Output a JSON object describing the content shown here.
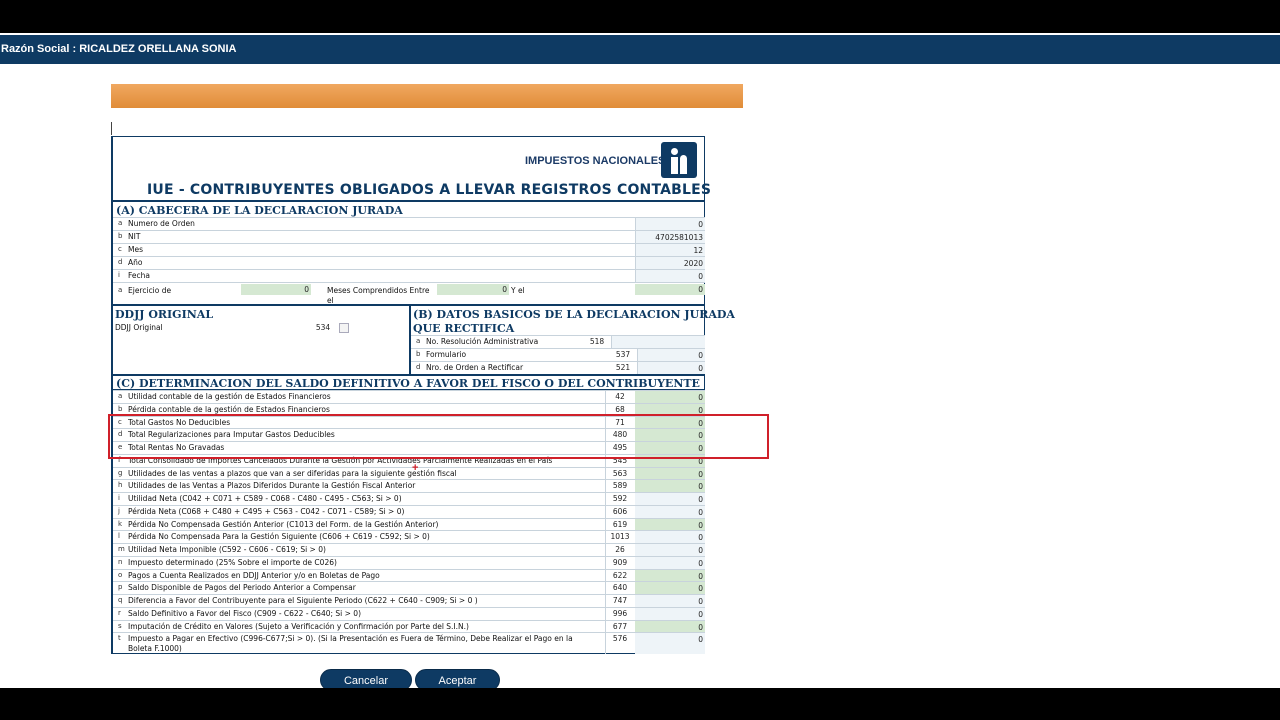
{
  "header": {
    "razon_social": "Razón Social : RICALDEZ ORELLANA SONIA"
  },
  "logo": {
    "text": "IMPUESTOS NACIONALES"
  },
  "title": "IUE - CONTRIBUYENTES OBLIGADOS A LLEVAR REGISTROS CONTABLES",
  "sectionA": {
    "title": "(A) CABECERA DE LA DECLARACION JURADA",
    "rows": [
      {
        "letter": "a",
        "label": "Numero de Orden",
        "value": "0"
      },
      {
        "letter": "b",
        "label": "NIT",
        "value": "4702581013"
      },
      {
        "letter": "c",
        "label": "Mes",
        "value": "12"
      },
      {
        "letter": "d",
        "label": "Año",
        "value": "2020"
      },
      {
        "letter": "i",
        "label": "Fecha",
        "value": "0"
      }
    ],
    "ejercicio": {
      "letter": "a",
      "label": "Ejercicio de",
      "value": "0",
      "meses_label": "Meses Comprendidos Entre el",
      "meses_value": "0",
      "yel_label": "Y el",
      "yel_value": "0"
    }
  },
  "ddjj": {
    "title": "DDJJ ORIGINAL",
    "label": "DDJJ Original",
    "code": "534"
  },
  "sectionB": {
    "title_line1": "(B) DATOS BASICOS DE LA DECLARACION JURADA",
    "title_line2": "QUE RECTIFICA",
    "rows": [
      {
        "letter": "a",
        "label": "No. Resolución Administrativa",
        "code": "518",
        "value": ""
      },
      {
        "letter": "b",
        "label": "Formulario",
        "code": "537",
        "value": "0"
      },
      {
        "letter": "d",
        "label": "Nro. de Orden a Rectificar",
        "code": "521",
        "value": "0"
      }
    ]
  },
  "sectionC": {
    "title": "(C) DETERMINACION DEL SALDO DEFINITIVO A FAVOR DEL FISCO O DEL CONTRIBUYENTE",
    "rows": [
      {
        "letter": "a",
        "label": "Utilidad contable de la gestión de Estados Financieros",
        "code": "42",
        "value": "0"
      },
      {
        "letter": "b",
        "label": "Pérdida contable de la gestión de Estados Financieros",
        "code": "68",
        "value": "0"
      },
      {
        "letter": "c",
        "label": "Total Gastos No Deducibles",
        "code": "71",
        "value": "0"
      },
      {
        "letter": "d",
        "label": "Total Regularizaciones para Imputar Gastos Deducibles",
        "code": "480",
        "value": "0"
      },
      {
        "letter": "e",
        "label": "Total Rentas No Gravadas",
        "code": "495",
        "value": "0"
      },
      {
        "letter": "f",
        "label": "Total Consolidado de Importes Cancelados Durante la Gestión por Actividades Parcialmente Realizadas en el País",
        "code": "545",
        "value": "0"
      },
      {
        "letter": "g",
        "label": "Utilidades de las ventas a plazos que van a ser diferidas para la siguiente gestión fiscal",
        "code": "563",
        "value": "0"
      },
      {
        "letter": "h",
        "label": "Utilidades de las Ventas a Plazos Diferidos Durante la Gestión Fiscal Anterior",
        "code": "589",
        "value": "0"
      },
      {
        "letter": "i",
        "label": "Utilidad Neta (C042 + C071 + C589 - C068 - C480 - C495 - C563; Si > 0)",
        "code": "592",
        "value": "0"
      },
      {
        "letter": "j",
        "label": "Pérdida Neta (C068 + C480 + C495 + C563 - C042 - C071 - C589; Si > 0)",
        "code": "606",
        "value": "0"
      },
      {
        "letter": "k",
        "label": "Pérdida No Compensada Gestión Anterior (C1013 del Form. de la Gestión Anterior)",
        "code": "619",
        "value": "0"
      },
      {
        "letter": "l",
        "label": "Pérdida No Compensada Para la Gestión Siguiente (C606 + C619 - C592; Si > 0)",
        "code": "1013",
        "value": "0"
      },
      {
        "letter": "m",
        "label": "Utilidad Neta Imponible (C592 - C606 - C619; Si > 0)",
        "code": "26",
        "value": "0"
      },
      {
        "letter": "n",
        "label": "Impuesto determinado (25% Sobre el importe de C026)",
        "code": "909",
        "value": "0"
      },
      {
        "letter": "o",
        "label": "Pagos a Cuenta Realizados en DDJJ Anterior y/o en Boletas de Pago",
        "code": "622",
        "value": "0"
      },
      {
        "letter": "p",
        "label": "Saldo Disponible de Pagos del Periodo Anterior a Compensar",
        "code": "640",
        "value": "0"
      },
      {
        "letter": "q",
        "label": "Diferencia a Favor del Contribuyente para el Siguiente Periodo (C622 + C640 - C909; Si > 0 )",
        "code": "747",
        "value": "0"
      },
      {
        "letter": "r",
        "label": "Saldo Definitivo a Favor del Fisco (C909 - C622 - C640; Si > 0)",
        "code": "996",
        "value": "0"
      },
      {
        "letter": "s",
        "label": "Imputación de Crédito en Valores (Sujeto a Verificación y Confirmación por Parte del S.I.N.)",
        "code": "677",
        "value": "0"
      },
      {
        "letter": "t",
        "label": "Impuesto a Pagar en Efectivo (C996-C677;Si > 0). (Si la Presentación es Fuera de Término, Debe Realizar el Pago en la",
        "label2": "Boleta F.1000)",
        "code": "576",
        "value": "0"
      }
    ]
  },
  "buttons": {
    "cancel": "Cancelar",
    "accept": "Aceptar"
  }
}
